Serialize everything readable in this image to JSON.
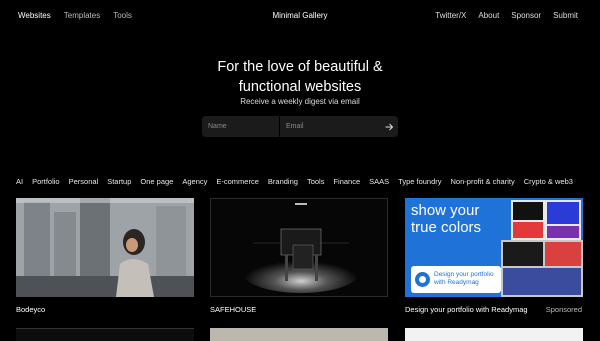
{
  "nav": {
    "left": [
      "Websites",
      "Templates",
      "Tools"
    ],
    "title": "Minimal Gallery",
    "right": [
      "Twitter/X",
      "About",
      "Sponsor",
      "Submit"
    ]
  },
  "hero": {
    "line1": "For the love of beautiful &",
    "line2": "functional websites",
    "subtitle": "Receive a weekly digest via email"
  },
  "signup": {
    "name_placeholder": "Name",
    "email_placeholder": "Email",
    "submit_icon": "arrow-right-icon"
  },
  "categories": [
    "AI",
    "Portfolio",
    "Personal",
    "Startup",
    "One page",
    "Agency",
    "E-commerce",
    "Branding",
    "Tools",
    "Finance",
    "SAAS",
    "Type foundry",
    "Non-profit & charity",
    "Crypto & web3"
  ],
  "cards": [
    {
      "title": "Bodeyco"
    },
    {
      "title": "SAFEHOUSE"
    },
    {
      "title": "Design your portfolio with Readymag",
      "badge": "Sponsored",
      "ad_headline_line1": "show your",
      "ad_headline_line2": "true colors",
      "ad_box_line1": "Design your portfolio",
      "ad_box_line2": "with Readymag"
    }
  ],
  "colors": {
    "background": "#000000",
    "ad_blue": "#1f73d8"
  }
}
